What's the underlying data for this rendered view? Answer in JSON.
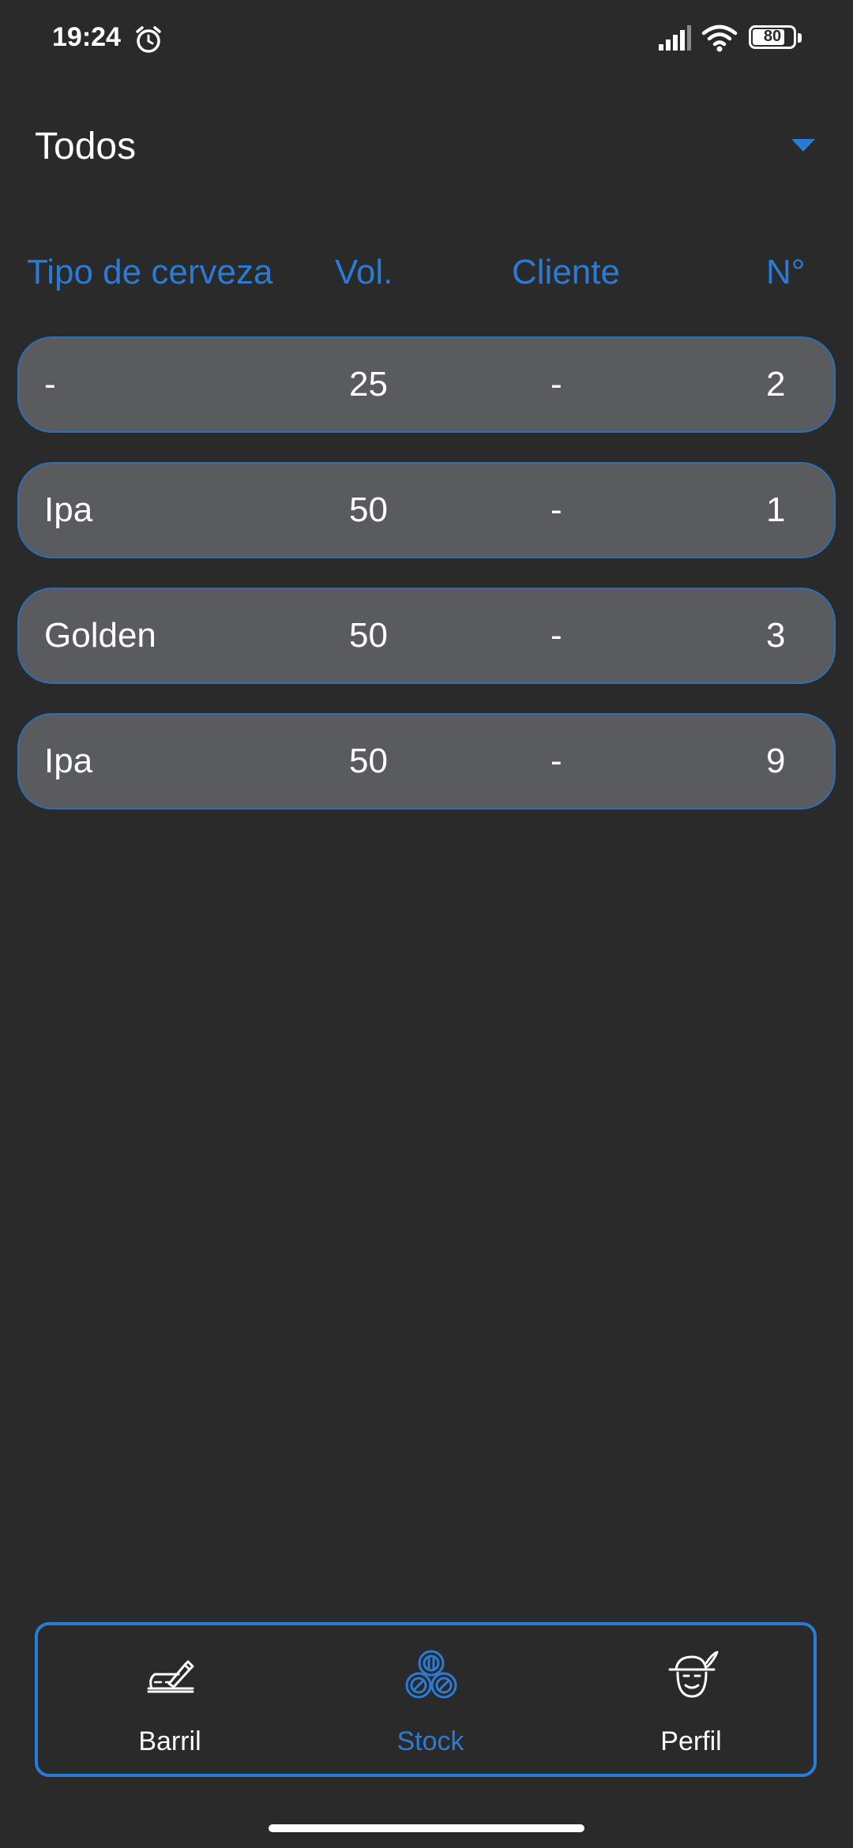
{
  "status_bar": {
    "time": "19:24",
    "battery": "80",
    "icons": [
      "alarm-icon",
      "signal-icon",
      "wifi-icon",
      "battery-icon"
    ]
  },
  "filter": {
    "selected": "Todos"
  },
  "table": {
    "headers": {
      "type": "Tipo de cerveza",
      "volume": "Vol.",
      "client": "Cliente",
      "number": "N°"
    },
    "rows": [
      {
        "type": "-",
        "volume": "25",
        "client": "-",
        "number": "2"
      },
      {
        "type": "Ipa",
        "volume": "50",
        "client": "-",
        "number": "1"
      },
      {
        "type": "Golden",
        "volume": "50",
        "client": "-",
        "number": "3"
      },
      {
        "type": "Ipa",
        "volume": "50",
        "client": "-",
        "number": "9"
      }
    ]
  },
  "bottom_nav": {
    "items": [
      {
        "label": "Barril",
        "icon": "barrel-pen-icon",
        "active": false
      },
      {
        "label": "Stock",
        "icon": "stacked-barrels-icon",
        "active": true
      },
      {
        "label": "Perfil",
        "icon": "brewer-face-icon",
        "active": false
      }
    ]
  },
  "colors": {
    "background": "#2a2a2a",
    "accent": "#2a7bd5",
    "row_background": "#5a5b5e",
    "text": "#ffffff"
  }
}
